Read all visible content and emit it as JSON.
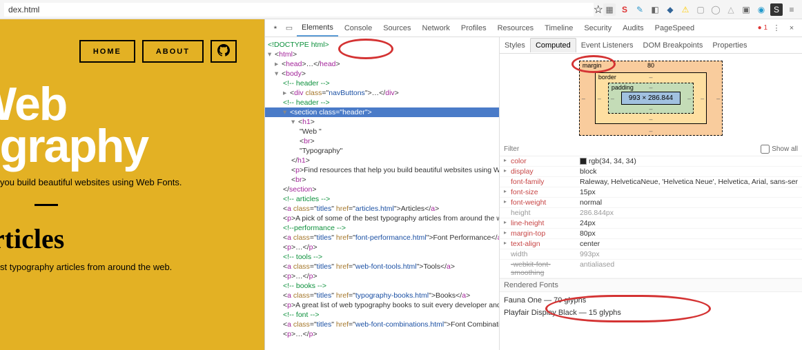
{
  "urlbar": {
    "value": "dex.html",
    "star_icon": "star-icon"
  },
  "extensions": [
    "ext-1",
    "ext-s",
    "ext-bird",
    "ext-cube",
    "ext-db",
    "ext-warn",
    "ext-folder",
    "ext-chat",
    "ext-cloud",
    "ext-sq",
    "ext-save-s",
    "ext-menu"
  ],
  "page": {
    "nav": {
      "home": "HOME",
      "about": "ABOUT"
    },
    "title_line1": "Web",
    "title_line2": "ography",
    "subtitle": "you build beautiful websites using Web Fonts.",
    "h2": "Articles",
    "sub2": "st typography articles from around the web."
  },
  "devtools": {
    "tabs": [
      "Elements",
      "Console",
      "Sources",
      "Network",
      "Profiles",
      "Resources",
      "Timeline",
      "Security",
      "Audits",
      "PageSpeed"
    ],
    "active_tab": "Elements",
    "errors": "1",
    "elements": {
      "doctype": "<!DOCTYPE html>",
      "html_open": "html",
      "head": "head",
      "header_comment": "<!-- header -->",
      "body": "body",
      "div_nav": {
        "tag": "div",
        "class": "navButtons"
      },
      "end_header_comment": "<!-- header -->",
      "section": {
        "tag": "section",
        "class": "header"
      },
      "h1": "h1",
      "h1_text1": "\"Web \"",
      "br": "br",
      "h1_text2": "\"Typography\"",
      "p_find": "Find resources that help you build beautiful websites using Web Fonts.",
      "articles_comment": "<!-- articles -->",
      "a_articles": {
        "class": "titles",
        "href": "articles.html",
        "text": "Articles"
      },
      "p_pick": "A pick of some of the best typography articles from around the web.",
      "perf_comment": "<!--performance -->",
      "a_perf": {
        "class": "titles",
        "href": "font-performance.html",
        "text": "Font Performance"
      },
      "tools_comment": "<!-- tools -->",
      "a_tools": {
        "class": "titles",
        "href": "web-font-tools.html",
        "text": "Tools"
      },
      "books_comment": "<!-- books -->",
      "a_books": {
        "class": "titles",
        "href": "typography-books.html",
        "text": "Books"
      },
      "p_books": "A great list of web typography books to suit every developer and designer.",
      "font_comment": "<!-- font -->",
      "a_font": {
        "class": "titles",
        "href": "web-font-combinations.html",
        "text": "Font Combinations"
      }
    },
    "sidebar_tabs": [
      "Styles",
      "Computed",
      "Event Listeners",
      "DOM Breakpoints",
      "Properties"
    ],
    "sidebar_active": "Computed",
    "boxmodel": {
      "margin": "margin",
      "margin_top": "80",
      "border": "border",
      "padding": "padding",
      "content": "993 × 286.844"
    },
    "filter_placeholder": "Filter",
    "show_all": "Show all",
    "props": [
      {
        "name": "color",
        "val": "rgb(34, 34, 34)",
        "swatch": "#222222"
      },
      {
        "name": "display",
        "val": "block"
      },
      {
        "name": "font-family",
        "val": "Raleway, HelveticaNeue, 'Helvetica Neue', Helvetica, Arial, sans-ser",
        "noarrow": true
      },
      {
        "name": "font-size",
        "val": "15px"
      },
      {
        "name": "font-weight",
        "val": "normal"
      },
      {
        "name": "height",
        "val": "286.844px",
        "dim": true
      },
      {
        "name": "line-height",
        "val": "24px"
      },
      {
        "name": "margin-top",
        "val": "80px"
      },
      {
        "name": "text-align",
        "val": "center"
      },
      {
        "name": "width",
        "val": "993px",
        "dim": true
      },
      {
        "name": "-webkit-font-smoothing",
        "val": "antialiased",
        "dim": true,
        "strike": true
      }
    ],
    "rendered_fonts_hdr": "Rendered Fonts",
    "rendered_fonts": [
      "Fauna One — 70 glyphs",
      "Playfair Display Black — 15 glyphs"
    ]
  }
}
